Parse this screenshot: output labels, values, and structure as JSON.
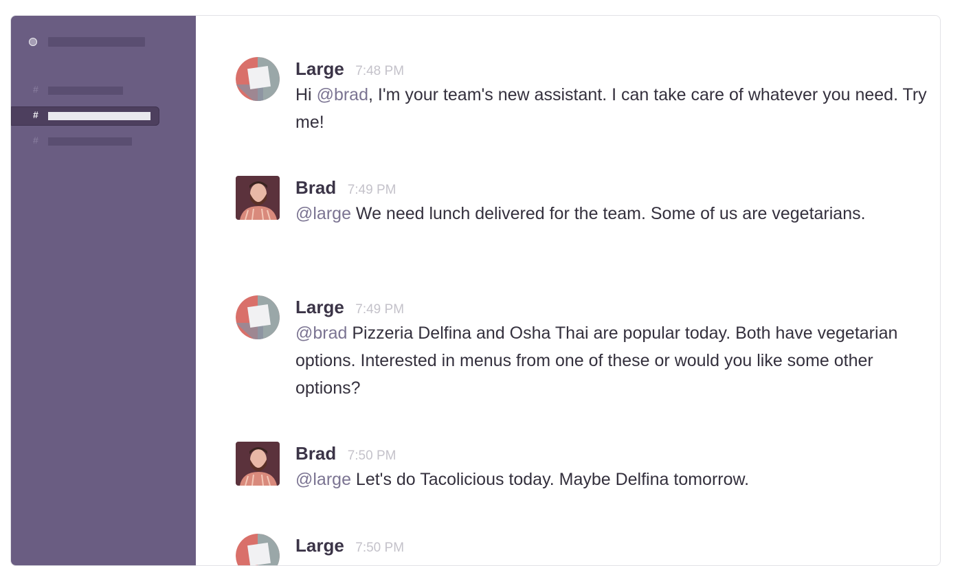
{
  "sidebar": {
    "team_status_icon": "status-dot-icon",
    "channels": [
      {
        "hash": "#",
        "active": false
      },
      {
        "hash": "#",
        "active": true
      },
      {
        "hash": "#",
        "active": false
      }
    ]
  },
  "messages": [
    {
      "author": "Large",
      "time": "7:48 PM",
      "avatar": "large-logo",
      "parts": [
        {
          "text": "Hi "
        },
        {
          "text": "@brad",
          "mention": true
        },
        {
          "text": ", I'm your team's new assistant. I can take care of whatever you need. Try me!"
        }
      ]
    },
    {
      "author": "Brad",
      "time": "7:49 PM",
      "avatar": "brad-photo",
      "parts": [
        {
          "text": "@large",
          "mention": true
        },
        {
          "text": " We need lunch delivered for the team. Some of us are vegetarians."
        }
      ]
    },
    {
      "author": "Large",
      "time": "7:49 PM",
      "avatar": "large-logo",
      "parts": [
        {
          "text": "@brad",
          "mention": true
        },
        {
          "text": " Pizzeria Delfina and Osha Thai are popular today. Both have vegetarian options. Interested in menus from one of these or would you like some other options?"
        }
      ]
    },
    {
      "author": "Brad",
      "time": "7:50 PM",
      "avatar": "brad-photo",
      "parts": [
        {
          "text": "@large",
          "mention": true
        },
        {
          "text": " Let's do Tacolicious today. Maybe Delfina tomorrow."
        }
      ]
    },
    {
      "author": "Large",
      "time": "7:50 PM",
      "avatar": "large-logo",
      "parts": []
    }
  ],
  "colors": {
    "sidebar": "#6a5d82",
    "mention": "#7b7492",
    "logo_red": "#d9706a",
    "logo_gray": "#9aa7a8"
  }
}
